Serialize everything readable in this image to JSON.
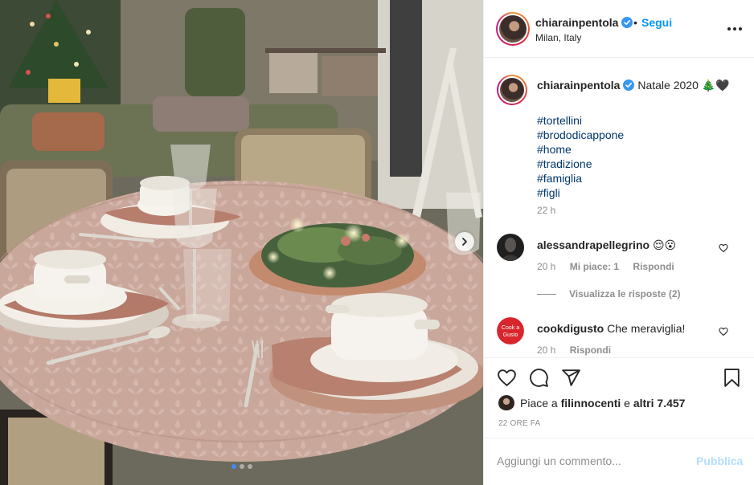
{
  "header": {
    "username": "chiarainpentola",
    "bullet": "•",
    "follow_label": "Segui",
    "location": "Milan, Italy",
    "more_icon": "more-horizontal-icon"
  },
  "caption": {
    "username": "chiarainpentola",
    "text": "Natale 2020 🎄🖤",
    "hashtags": [
      "#tortellini",
      "#brododicappone",
      "#home",
      "#tradizione",
      "#famiglia",
      "#figli"
    ],
    "time": "22 h"
  },
  "comments": [
    {
      "username": "alessandrapellegrino",
      "text": "😌😮",
      "time": "20 h",
      "likes": "Mi piace: 1",
      "reply_label": "Rispondi",
      "view_replies": "Visualizza le risposte (2)"
    },
    {
      "username": "cookdigusto",
      "text": "Che meraviglia!",
      "time": "20 h",
      "reply_label": "Rispondi",
      "avatar_text": "Cook a Gusto"
    }
  ],
  "actions": {
    "icons": [
      "heart-icon",
      "comment-icon",
      "share-icon",
      "bookmark-icon"
    ]
  },
  "likes": {
    "prefix": "Piace a",
    "user": "filinnocenti",
    "middle": "e",
    "others": "altri 7.457"
  },
  "posted_ago": "22 ORE FA",
  "add_comment": {
    "placeholder": "Aggiungi un commento...",
    "publish_label": "Pubblica"
  },
  "carousel": {
    "slides": 3,
    "active_slide": 1
  },
  "colors": {
    "accent_blue": "#0095f6",
    "hashtag_blue": "#00376b",
    "muted_gray": "#8e8e8e",
    "publish_disabled": "#b2dffc",
    "tablecloth": "#c8a69b"
  }
}
